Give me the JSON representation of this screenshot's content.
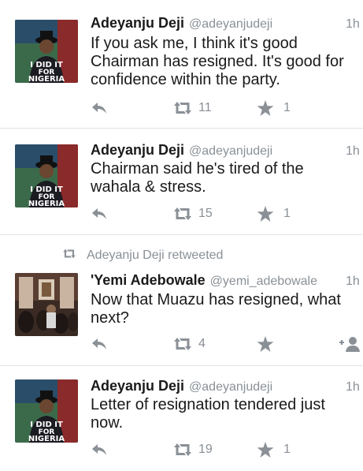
{
  "tweets": [
    {
      "name": "Adeyanju Deji",
      "handle": "@adeyanjudeji",
      "time": "1h",
      "text_lines": [
        "If you ask me, I think it's good",
        "Chairman has resigned. It's good for",
        "confidence within the party."
      ],
      "retweets": "11",
      "favorites": "1",
      "avatar_text": [
        "I DID IT",
        "FOR",
        "NIGERIA"
      ]
    },
    {
      "name": "Adeyanju Deji",
      "handle": "@adeyanjudeji",
      "time": "1h",
      "text_lines": [
        "Chairman said he's tired of the",
        "wahala & stress."
      ],
      "retweets": "15",
      "favorites": "1",
      "avatar_text": [
        "I DID IT",
        "FOR",
        "NIGERIA"
      ]
    },
    {
      "retweet_context": "Adeyanju Deji retweeted",
      "name": "'Yemi Adebowale",
      "handle": "@yemi_adebowale",
      "time": "1h",
      "text_lines": [
        "Now that Muazu has resigned, what",
        "next?"
      ],
      "retweets": "4",
      "favorites": ""
    },
    {
      "name": "Adeyanju Deji",
      "handle": "@adeyanjudeji",
      "time": "1h",
      "text_lines": [
        "Letter of resignation tendered just",
        "now."
      ],
      "retweets": "19",
      "favorites": "1",
      "avatar_text": [
        "I DID IT",
        "FOR",
        "NIGERIA"
      ]
    }
  ],
  "icons": {
    "reply": "reply-icon",
    "retweet": "retweet-icon",
    "favorite": "star-icon",
    "follow": "add-user-icon"
  },
  "colors": {
    "icon_gray": "#8a9096",
    "text": "#1a1a1a",
    "avatar_green": "#2f7a3a"
  }
}
